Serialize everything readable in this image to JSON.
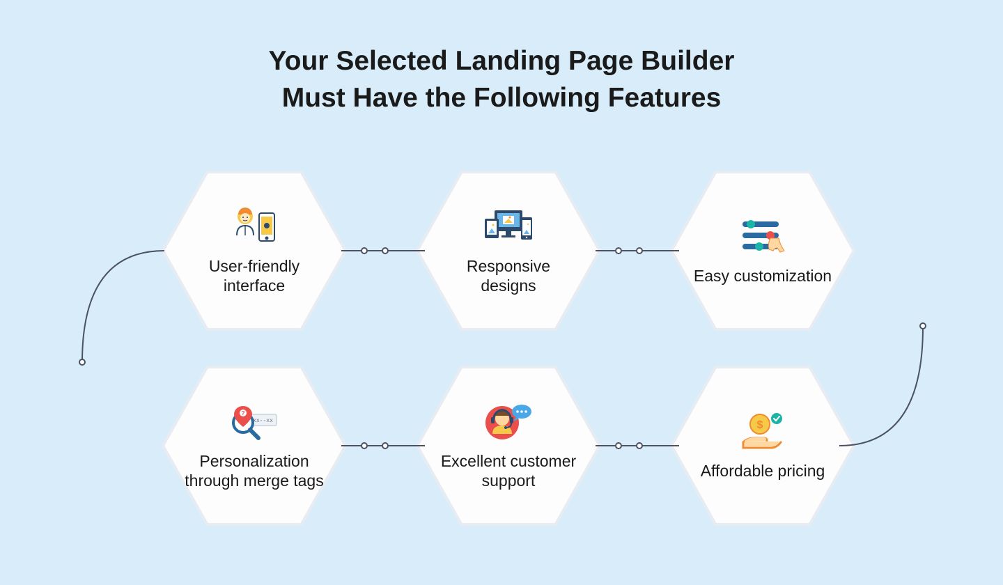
{
  "title_line1": "Your Selected Landing Page Builder",
  "title_line2": "Must Have the Following Features",
  "features": {
    "f0": {
      "label": "User-friendly interface",
      "icon": "user-phone-icon"
    },
    "f1": {
      "label": "Responsive designs",
      "icon": "devices-icon"
    },
    "f2": {
      "label": "Easy customization",
      "icon": "sliders-icon"
    },
    "f3": {
      "label": "Personalization through merge tags",
      "icon": "search-tag-icon"
    },
    "f4": {
      "label": "Excellent customer support",
      "icon": "support-agent-icon"
    },
    "f5": {
      "label": "Affordable pricing",
      "icon": "coin-hand-icon"
    }
  },
  "colors": {
    "bg": "#d8edf9",
    "hex_fill": "#fdfdfe",
    "hex_stroke": "#e7ecf2",
    "connector": "#4c5163",
    "accent_yellow": "#f7c948",
    "accent_orange": "#f08b2e",
    "accent_red": "#ea4f4c",
    "accent_teal": "#1db4a8",
    "accent_blue": "#2a6aa0",
    "accent_navy": "#2c4a6b"
  }
}
